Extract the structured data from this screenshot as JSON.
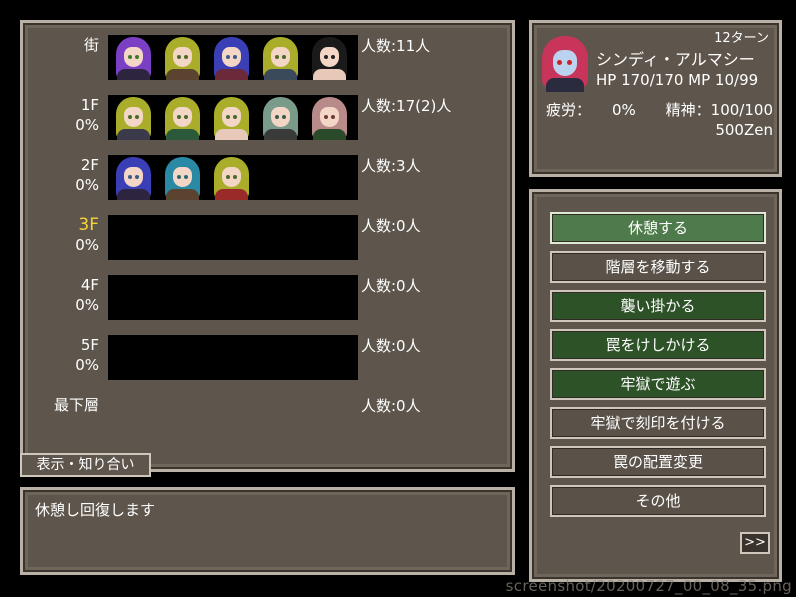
{
  "floors": [
    {
      "label": "街",
      "pct": "",
      "count": "人数:11人",
      "current": false,
      "strip": true,
      "portraits": [
        {
          "hair": "#7b3fc3",
          "body": "#2d2540",
          "eye": "#3a7a2a"
        },
        {
          "hair": "#a9ad2a",
          "body": "#5a4430",
          "eye": "#4a6a2a"
        },
        {
          "hair": "#3b3fb5",
          "body": "#6a2a3a",
          "eye": "#3a5a8a"
        },
        {
          "hair": "#a9ad2a",
          "body": "#3a4a5a",
          "eye": "#4a6a2a"
        },
        {
          "hair": "#1a1a1a",
          "body": "#e8c8b8",
          "eye": "#222222"
        }
      ]
    },
    {
      "label": "1F",
      "pct": "0%",
      "count": "人数:17(2)人",
      "current": false,
      "strip": true,
      "portraits": [
        {
          "hair": "#a9ad2a",
          "body": "#3a3a4a",
          "eye": "#4a6a2a"
        },
        {
          "hair": "#a9ad2a",
          "body": "#2a5a3a",
          "eye": "#4a6a2a"
        },
        {
          "hair": "#a9ad2a",
          "body": "#e8c8b8",
          "eye": "#4a6a2a"
        },
        {
          "hair": "#7a9a8a",
          "body": "#3a3a3a",
          "eye": "#3a5a4a"
        },
        {
          "hair": "#b98a8a",
          "body": "#2a4a2a",
          "eye": "#6a3a3a"
        }
      ]
    },
    {
      "label": "2F",
      "pct": "0%",
      "count": "人数:3人",
      "current": false,
      "strip": true,
      "portraits": [
        {
          "hair": "#3b3fb5",
          "body": "#2d2540",
          "eye": "#3a5a8a"
        },
        {
          "hair": "#2a8aa5",
          "body": "#5a4430",
          "eye": "#2a6a6a"
        },
        {
          "hair": "#a9ad2a",
          "body": "#9a2a2a",
          "eye": "#4a6a2a"
        }
      ]
    },
    {
      "label": "3F",
      "pct": "0%",
      "count": "人数:0人",
      "current": true,
      "strip": true,
      "portraits": []
    },
    {
      "label": "4F",
      "pct": "0%",
      "count": "人数:0人",
      "current": false,
      "strip": true,
      "portraits": []
    },
    {
      "label": "5F",
      "pct": "0%",
      "count": "人数:0人",
      "current": false,
      "strip": true,
      "portraits": []
    },
    {
      "label": "最下層",
      "pct": "",
      "count": "人数:0人",
      "current": false,
      "strip": false,
      "portraits": []
    }
  ],
  "status": {
    "turn": "12ターン",
    "name": "シンディ・アルマシー",
    "hp_mp": "HP  170/170 MP  10/99",
    "fatigue_label": "疲労：",
    "fatigue_value": "0%",
    "spirit": "精神：100/100",
    "money": "500Zen"
  },
  "menu": [
    {
      "label": "休憩する",
      "style": "selected"
    },
    {
      "label": "階層を移動する",
      "style": "normal"
    },
    {
      "label": "襲い掛かる",
      "style": "green"
    },
    {
      "label": "罠をけしかける",
      "style": "green"
    },
    {
      "label": "牢獄で遊ぶ",
      "style": "green"
    },
    {
      "label": "牢獄で刻印を付ける",
      "style": "normal"
    },
    {
      "label": "罠の配置変更",
      "style": "normal"
    },
    {
      "label": "その他",
      "style": "normal"
    }
  ],
  "next_button": ">>",
  "tab_button": "表示・知り合い",
  "message": "休憩し回復します",
  "watermark": "screenshot/20200727_00_08_35.png"
}
